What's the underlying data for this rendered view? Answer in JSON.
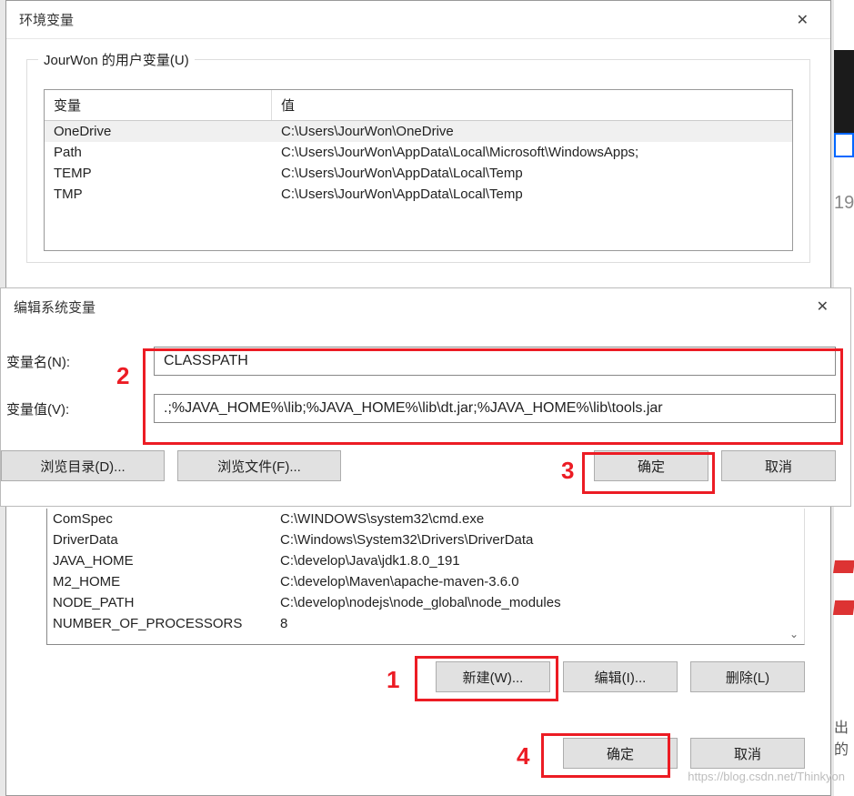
{
  "bg": {
    "num": "19",
    "txt": "出的"
  },
  "watermark": "https://blog.csdn.net/Thinkyon",
  "envDialog": {
    "title": "环境变量",
    "userGroupLegend": "JourWon 的用户变量(U)",
    "headers": {
      "var": "变量",
      "val": "值"
    },
    "userVars": [
      {
        "name": "OneDrive",
        "value": "C:\\Users\\JourWon\\OneDrive"
      },
      {
        "name": "Path",
        "value": "C:\\Users\\JourWon\\AppData\\Local\\Microsoft\\WindowsApps;"
      },
      {
        "name": "TEMP",
        "value": "C:\\Users\\JourWon\\AppData\\Local\\Temp"
      },
      {
        "name": "TMP",
        "value": "C:\\Users\\JourWon\\AppData\\Local\\Temp"
      }
    ],
    "systemVars": [
      {
        "name": "ComSpec",
        "value": "C:\\WINDOWS\\system32\\cmd.exe"
      },
      {
        "name": "DriverData",
        "value": "C:\\Windows\\System32\\Drivers\\DriverData"
      },
      {
        "name": "JAVA_HOME",
        "value": "C:\\develop\\Java\\jdk1.8.0_191"
      },
      {
        "name": "M2_HOME",
        "value": "C:\\develop\\Maven\\apache-maven-3.6.0"
      },
      {
        "name": "NODE_PATH",
        "value": "C:\\develop\\nodejs\\node_global\\node_modules"
      },
      {
        "name": "NUMBER_OF_PROCESSORS",
        "value": "8"
      }
    ],
    "buttons": {
      "new": "新建(W)...",
      "edit": "编辑(I)...",
      "del": "删除(L)",
      "ok": "确定",
      "cancel": "取消"
    }
  },
  "editDialog": {
    "title": "编辑系统变量",
    "nameLabel": "变量名(N):",
    "valueLabel": "变量值(V):",
    "nameValue": "CLASSPATH",
    "valueValue": ".;%JAVA_HOME%\\lib;%JAVA_HOME%\\lib\\dt.jar;%JAVA_HOME%\\lib\\tools.jar",
    "buttons": {
      "browseDir": "浏览目录(D)...",
      "browseFile": "浏览文件(F)...",
      "ok": "确定",
      "cancel": "取消"
    }
  },
  "annotations": {
    "a1": "1",
    "a2": "2",
    "a3": "3",
    "a4": "4"
  }
}
